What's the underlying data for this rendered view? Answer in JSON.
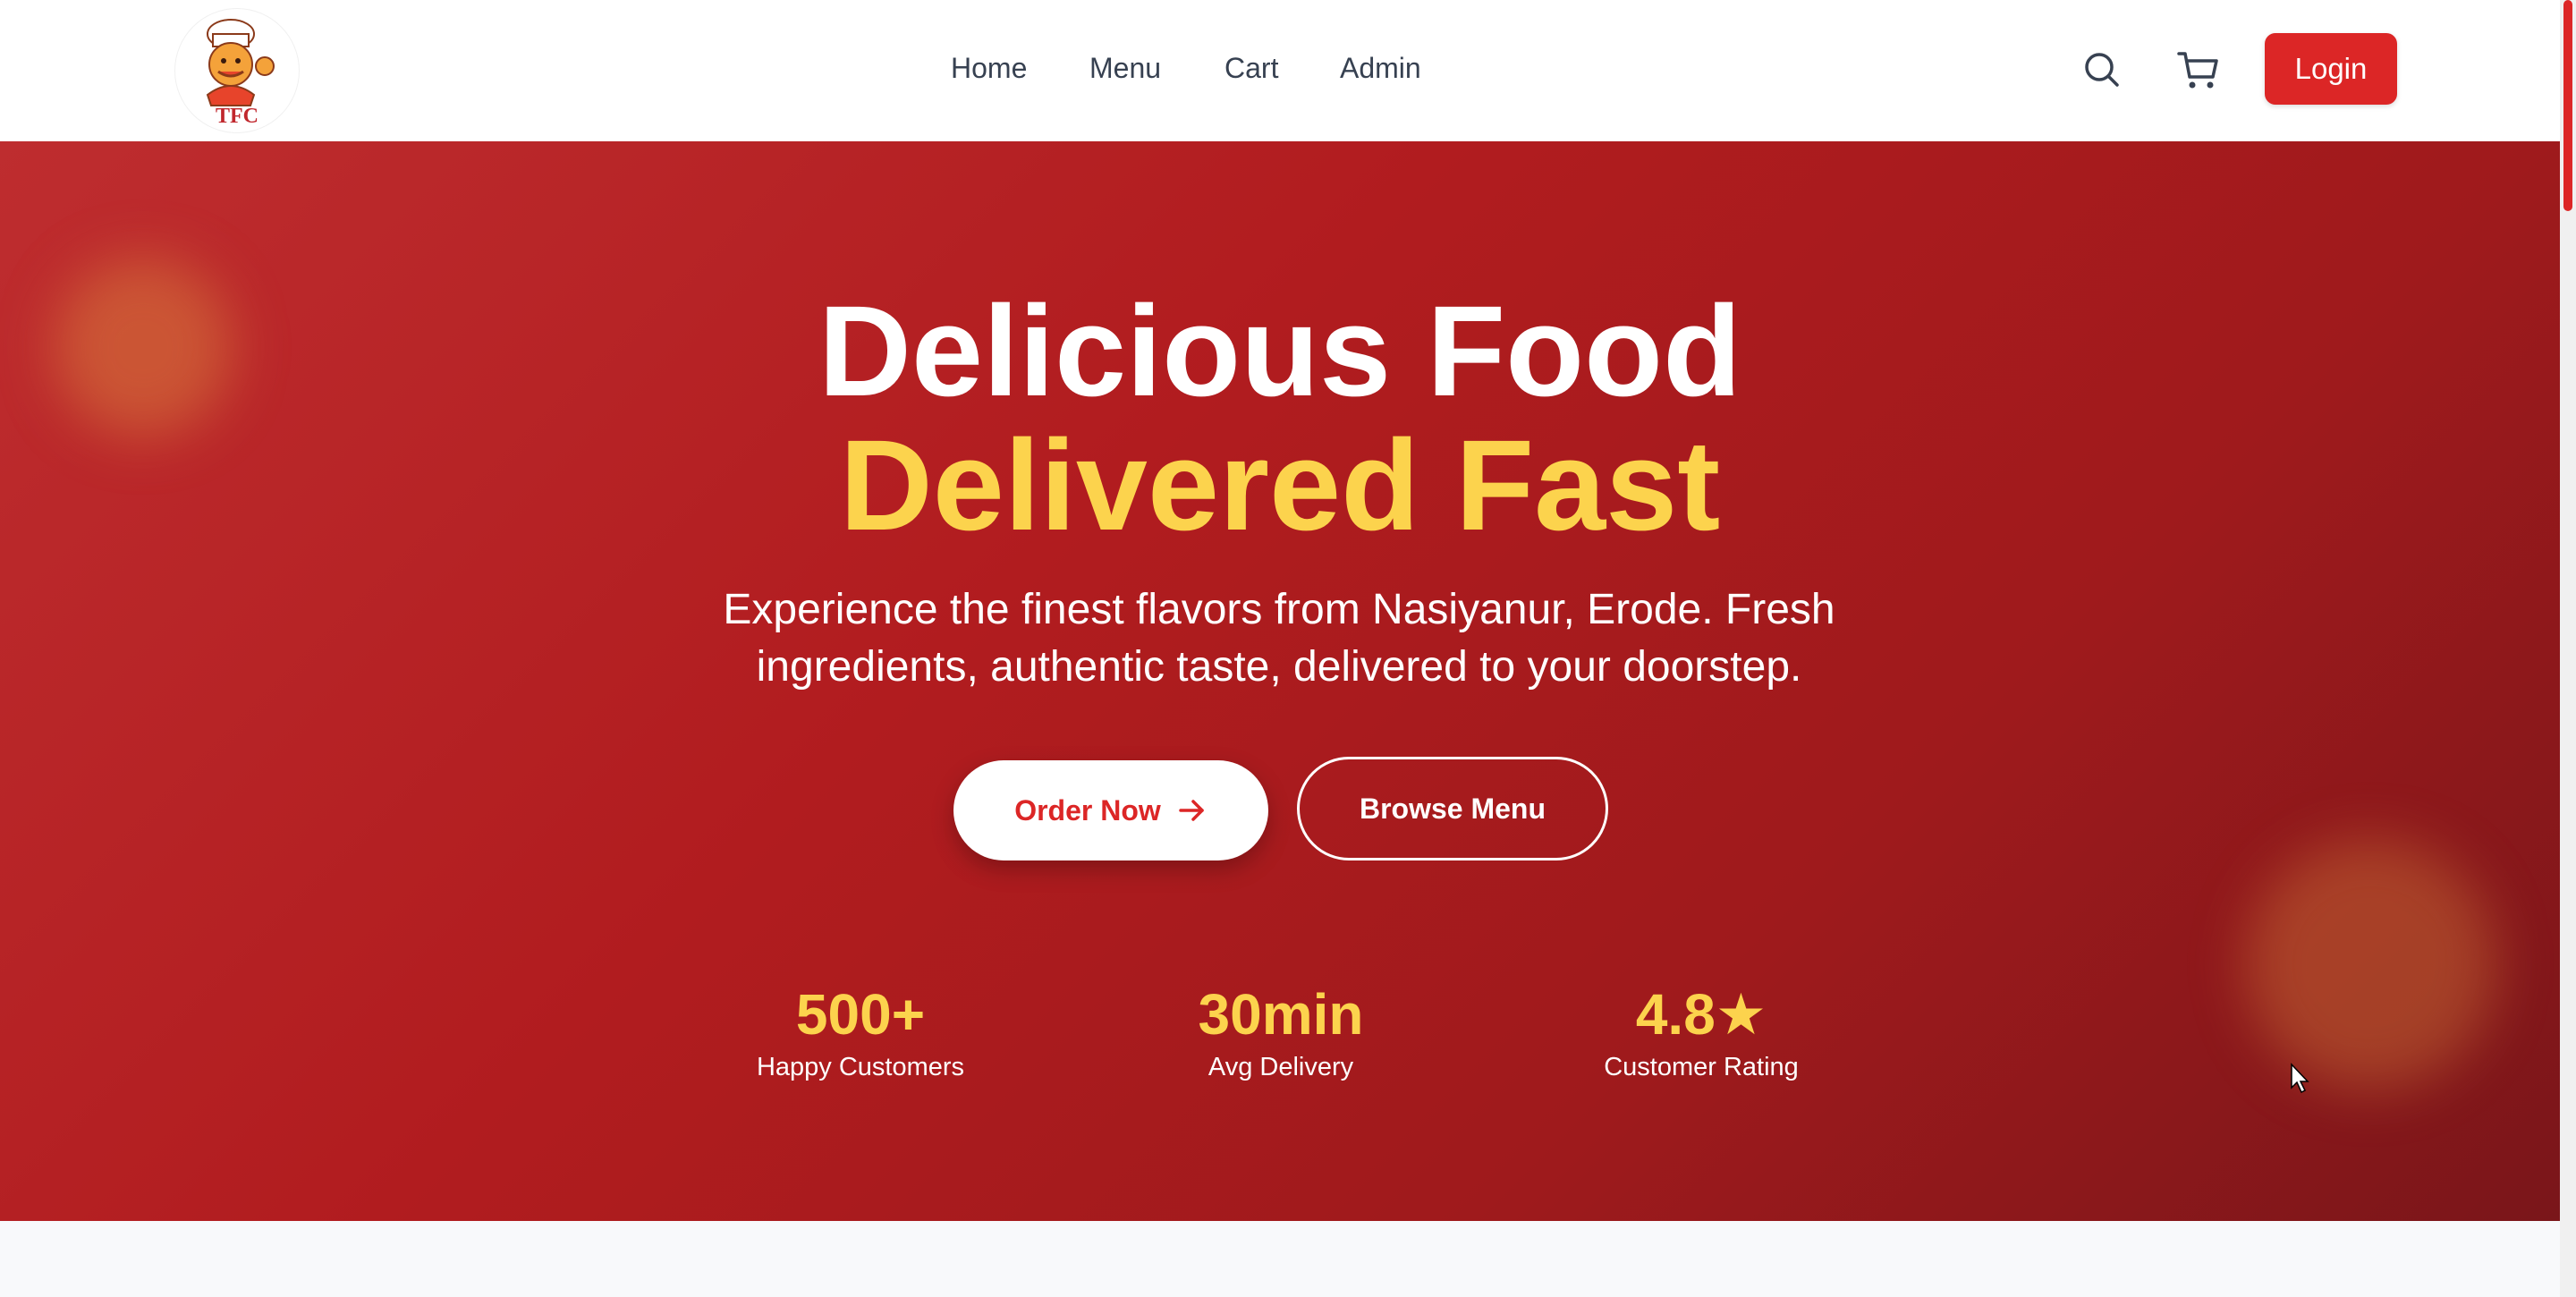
{
  "header": {
    "logo_text": "TFC",
    "nav": [
      "Home",
      "Menu",
      "Cart",
      "Admin"
    ],
    "icons": [
      "search-icon",
      "cart-icon"
    ],
    "login_label": "Login"
  },
  "hero": {
    "title_line1": "Delicious Food",
    "title_line2": "Delivered Fast",
    "subtitle": "Experience the finest flavors from Nasiyanur, Erode. Fresh ingredients, authentic taste, delivered to your doorstep.",
    "order_button": "Order Now",
    "browse_button": "Browse Menu",
    "stats": [
      {
        "value": "500+",
        "label": "Happy Customers"
      },
      {
        "value": "30min",
        "label": "Avg Delivery"
      },
      {
        "value": "4.8★",
        "label": "Customer Rating"
      }
    ]
  },
  "colors": {
    "primary": "#dc2626",
    "hero_bg": "#b11c1f",
    "accent": "#fcd34d",
    "text_dark": "#374151"
  }
}
